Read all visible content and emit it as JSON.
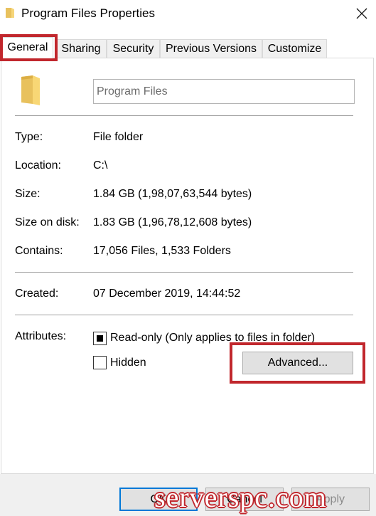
{
  "window": {
    "title": "Program Files Properties"
  },
  "tabs": [
    {
      "label": "General"
    },
    {
      "label": "Sharing"
    },
    {
      "label": "Security"
    },
    {
      "label": "Previous Versions"
    },
    {
      "label": "Customize"
    }
  ],
  "general": {
    "name_value": "Program Files",
    "type_label": "Type:",
    "type_value": "File folder",
    "location_label": "Location:",
    "location_value": "C:\\",
    "size_label": "Size:",
    "size_value": "1.84 GB (1,98,07,63,544 bytes)",
    "size_on_disk_label": "Size on disk:",
    "size_on_disk_value": "1.83 GB (1,96,78,12,608 bytes)",
    "contains_label": "Contains:",
    "contains_value": "17,056 Files, 1,533 Folders",
    "created_label": "Created:",
    "created_value": "07 December 2019, 14:44:52",
    "attributes_label": "Attributes:",
    "readonly_label": "Read-only (Only applies to files in folder)",
    "readonly_state": "indeterminate",
    "hidden_label": "Hidden",
    "hidden_checked": false,
    "advanced_button": "Advanced..."
  },
  "footer": {
    "ok_button": "OK",
    "cancel_button": "Cancel",
    "apply_button": "Apply"
  },
  "watermark": "serverspc.com",
  "colors": {
    "highlight": "#c1272d",
    "folder": "#e8c15d",
    "accent": "#0078d7"
  },
  "icons": [
    "folder-icon",
    "close-icon"
  ]
}
